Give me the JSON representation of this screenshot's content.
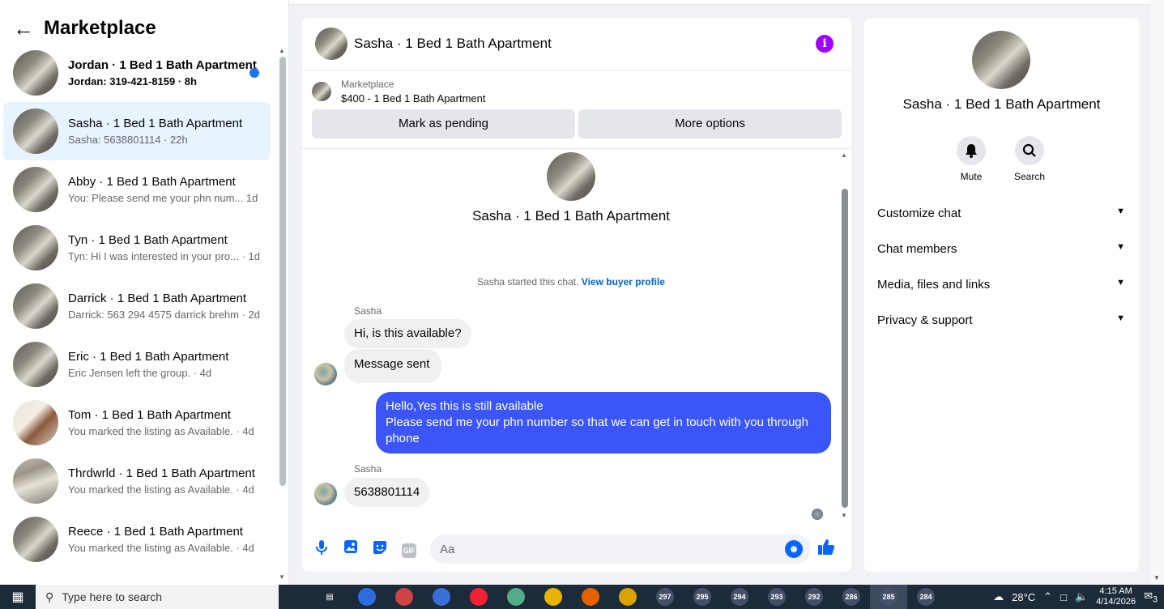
{
  "sidebar": {
    "title": "Marketplace",
    "conversations": [
      {
        "name": "Jordan · 1 Bed 1 Bath Apartment",
        "preview": "Jordan: 319-421-8159 · 8h",
        "unread": true
      },
      {
        "name": "Sasha · 1 Bed 1 Bath Apartment",
        "preview": "Sasha: 5638801114 · 22h",
        "active": true
      },
      {
        "name": "Abby · 1 Bed 1 Bath Apartment",
        "preview": "You: Please send me your phn num...  1d"
      },
      {
        "name": "Tyn · 1 Bed 1 Bath Apartment",
        "preview": "Tyn: Hi I was interested in your pro... · 1d"
      },
      {
        "name": "Darrick · 1 Bed 1 Bath Apartment",
        "preview": "Darrick: 563 294 4575 darrick brehm · 2d"
      },
      {
        "name": "Eric · 1 Bed 1 Bath Apartment",
        "preview": "Eric Jensen left the group. · 4d"
      },
      {
        "name": "Tom · 1 Bed 1 Bath Apartment",
        "preview": "You marked the listing as Available. · 4d"
      },
      {
        "name": "Thrdwrld · 1 Bed 1 Bath Apartment",
        "preview": "You marked the listing as Available. · 4d"
      },
      {
        "name": "Reece · 1 Bed 1 Bath Apartment",
        "preview": "You marked the listing as Available. · 4d"
      }
    ]
  },
  "chat": {
    "title": "Sasha · 1 Bed 1 Bath Apartment",
    "listing": {
      "label": "Marketplace",
      "price_title": "$400 - 1 Bed 1 Bath Apartment",
      "btn_pending": "Mark as pending",
      "btn_more": "More options"
    },
    "profile_name": "Sasha · 1 Bed 1 Bath Apartment",
    "started_text": "Sasha started this chat.",
    "started_link": "View buyer profile",
    "messages": [
      {
        "sender": "Sasha",
        "text": "Hi, is this available?"
      },
      {
        "text": "Message sent"
      },
      {
        "text": "Hello,Yes this is still available\nPlease send me your phn number so that we can get in touch with you through phone",
        "outgoing": true
      },
      {
        "sender": "Sasha",
        "text": "5638801114"
      }
    ],
    "composer_placeholder": "Aa",
    "gif_label": "GIF"
  },
  "details": {
    "name": "Sasha · 1 Bed 1 Bath Apartment",
    "mute_label": "Mute",
    "search_label": "Search",
    "sections": [
      "Customize chat",
      "Chat members",
      "Media, files and links",
      "Privacy & support"
    ]
  },
  "taskbar": {
    "search_placeholder": "Type here to search",
    "badges": [
      "297",
      "295",
      "294",
      "293",
      "292",
      "286",
      "285",
      "284"
    ],
    "temperature": "28°C",
    "time": "4:15 AM",
    "date": "4/14/2026",
    "notification_count": "3"
  }
}
